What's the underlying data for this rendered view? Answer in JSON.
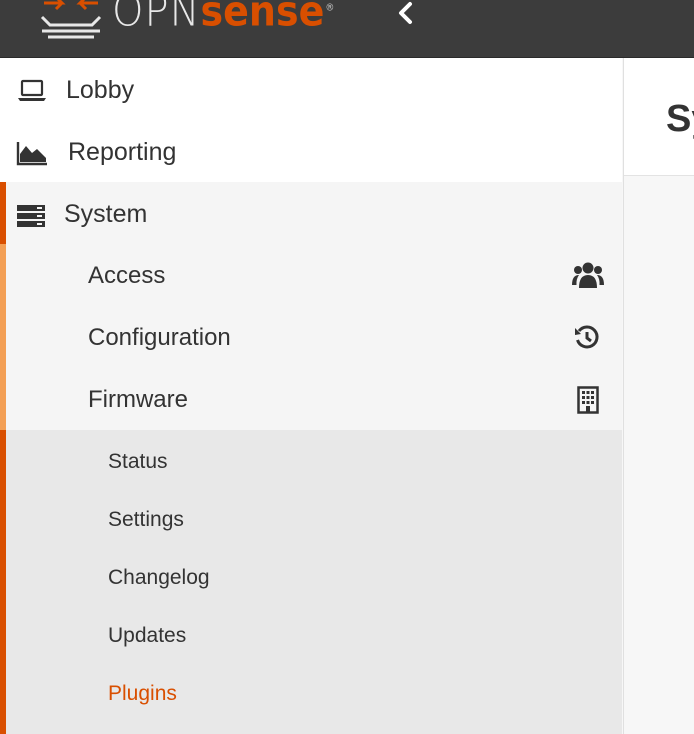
{
  "brand": {
    "name_prefix": "OPN",
    "name_suffix": "sense",
    "registered": "®",
    "accent_color": "#d94f00"
  },
  "header": {
    "collapse_icon": "chevron-left-icon"
  },
  "sidebar": {
    "items": [
      {
        "label": "Lobby",
        "icon": "laptop-icon"
      },
      {
        "label": "Reporting",
        "icon": "area-chart-icon"
      },
      {
        "label": "System",
        "icon": "server-icon",
        "expanded": true
      }
    ],
    "system_children": [
      {
        "label": "Access",
        "icon": "users-icon"
      },
      {
        "label": "Configuration",
        "icon": "history-icon"
      },
      {
        "label": "Firmware",
        "icon": "building-icon",
        "expanded": true
      }
    ],
    "firmware_children": [
      {
        "label": "Status"
      },
      {
        "label": "Settings"
      },
      {
        "label": "Changelog"
      },
      {
        "label": "Updates"
      },
      {
        "label": "Plugins",
        "active": true
      }
    ]
  },
  "main": {
    "page_title": "System: Firmware"
  }
}
